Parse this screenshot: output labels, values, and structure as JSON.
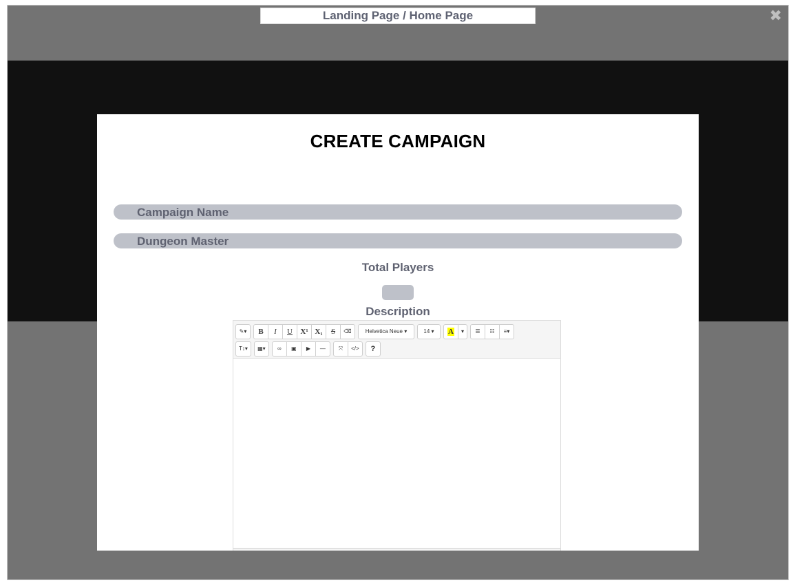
{
  "window": {
    "title": "Landing Page / Home Page",
    "close_glyph": "✖",
    "close_icon": "close-icon"
  },
  "modal": {
    "title": "CREATE CAMPAIGN",
    "campaign_name_placeholder": "Campaign Name",
    "dungeon_master_placeholder": "Dungeon Master",
    "total_players_label": "Total Players",
    "total_players_value": "",
    "description_label": "Description"
  },
  "editor": {
    "toolbar_row1": {
      "style_glyph": "✎▾",
      "bold": "B",
      "italic": "I",
      "underline": "U",
      "superscript": "X¹",
      "subscript": "X₁",
      "strikethrough": "S",
      "clear_glyph": "⌫",
      "font_name": "Helvetica Neue ▾",
      "font_size": "14 ▾",
      "color_letter": "A",
      "color_caret": "▾",
      "ul_glyph": "☰",
      "ol_glyph": "☷",
      "paragraph_glyph": "≡▾"
    },
    "toolbar_row2": {
      "height_glyph": "T↕▾",
      "table_glyph": "▦▾",
      "link_glyph": "∞",
      "picture_glyph": "▣",
      "video_glyph": "▶",
      "hr_glyph": "—",
      "fullscreen_glyph": "⤧",
      "codeview_glyph": "</>",
      "help_glyph": "?"
    },
    "content": ""
  },
  "colors": {
    "frame_bg": "#737373",
    "band_bg": "#111111",
    "pill_bg": "#bec1c9",
    "label_text": "#5f6271",
    "highlight": "#ffff00"
  }
}
